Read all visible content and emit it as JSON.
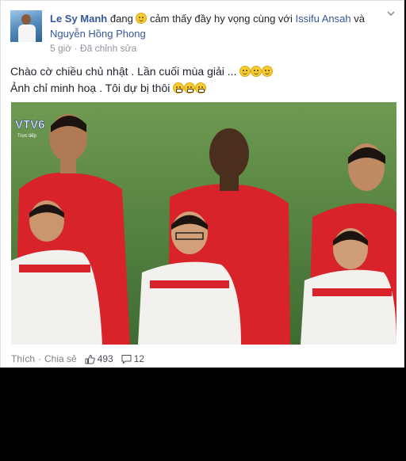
{
  "post": {
    "author": "Le Sy Manh",
    "status_prefix": "đang",
    "feeling": "cảm thấy đầy hy vọng cùng với",
    "tag1": "Issifu Ansah",
    "joiner": "và",
    "tag2": "Nguyễn Hồng Phong",
    "time": "5 giờ",
    "meta_sep": "·",
    "edited": "Đã chỉnh sửa",
    "line1": "Chào cờ chiều chủ nhật . Lần cuối mùa giải ...",
    "line2": "Ảnh chỉ minh hoạ . Tôi dự bị thôi"
  },
  "photo": {
    "watermark": "VTV6",
    "watermark_sub": "Trực tiếp"
  },
  "actions": {
    "like_label": "Thích",
    "sep": "·",
    "share_label": "Chia sẻ",
    "likes": "493",
    "comments": "12"
  },
  "colors": {
    "link": "#365899",
    "text": "#1d2129",
    "meta": "#90949c",
    "jersey_red": "#d8232a"
  },
  "icons": [
    "chevron-down-icon",
    "smiley-emoji",
    "grimace-emoji",
    "thumbs-up-icon",
    "comment-icon"
  ]
}
